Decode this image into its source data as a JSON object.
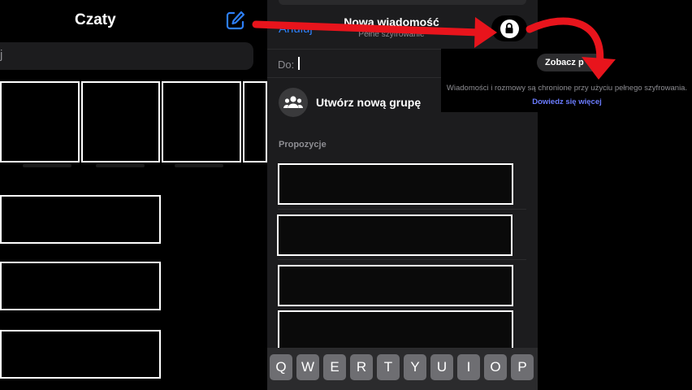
{
  "chats": {
    "title": "Czaty",
    "compose_icon": "compose-icon",
    "search_placeholder_fragment": "j"
  },
  "new_message": {
    "cancel_label": "Anuluj",
    "title": "Nowa wiadomość",
    "subtitle": "Pełne szyfrowanie",
    "to_label": "Do:",
    "create_group_label": "Utwórz nową grupę",
    "create_group_icon": "group-icon",
    "suggestions_label": "Propozycje"
  },
  "keyboard": {
    "keys": [
      "Q",
      "W",
      "E",
      "R",
      "T",
      "Y",
      "U",
      "I",
      "O",
      "P"
    ]
  },
  "encryption_info": {
    "lock_icon": "lock-icon",
    "see_button_label": "Zobacz p",
    "message": "Wiadomości i rozmowy są chronione przy użyciu pełnego szyfrowania.",
    "learn_more": "Dowiedz się więcej"
  },
  "colors": {
    "accent_blue": "#2d7ff9",
    "link_purple": "#6b7cff",
    "annotation_red": "#e8141c"
  }
}
